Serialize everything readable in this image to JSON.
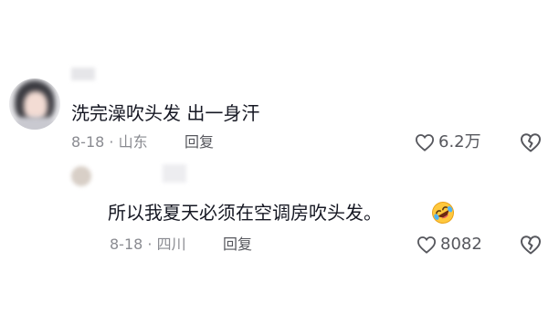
{
  "comments": [
    {
      "text": "洗完澡吹头发 出一身汗",
      "date": "8-18",
      "separator": "·",
      "location": "山东",
      "reply_label": "回复",
      "likes": "6.2万"
    },
    {
      "text": "所以我夏天必须在空调房吹头发。",
      "date": "8-18",
      "separator": "·",
      "location": "四川",
      "reply_label": "回复",
      "likes": "8082",
      "emoji": "rolling-on-floor-laughing-emoji"
    }
  ],
  "icons": {
    "like": "heart-outline-icon",
    "dislike": "broken-heart-outline-icon"
  },
  "colors": {
    "text": "#161823",
    "meta": "#8a8b91",
    "action": "#56575d"
  }
}
